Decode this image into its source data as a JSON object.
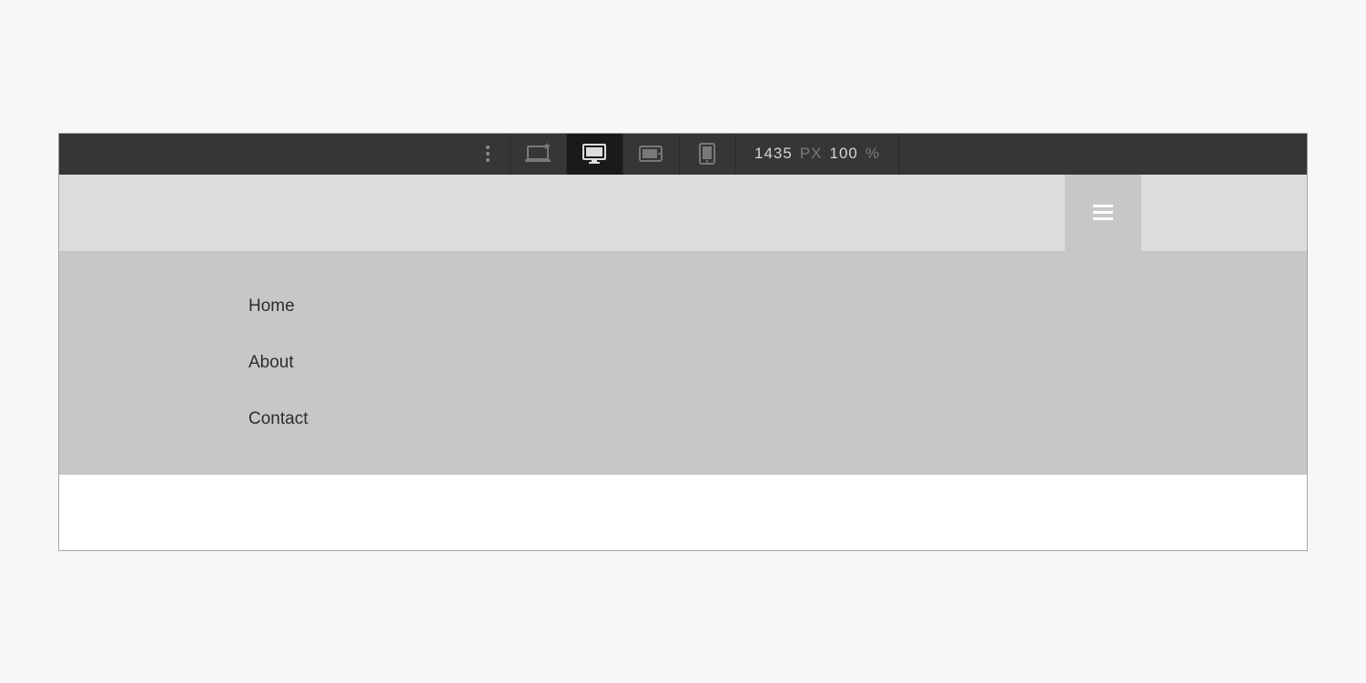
{
  "toolbar": {
    "width_value": "1435",
    "width_unit": "PX",
    "zoom_value": "100",
    "zoom_unit": "%"
  },
  "menu": {
    "items": [
      "Home",
      "About",
      "Contact"
    ]
  }
}
